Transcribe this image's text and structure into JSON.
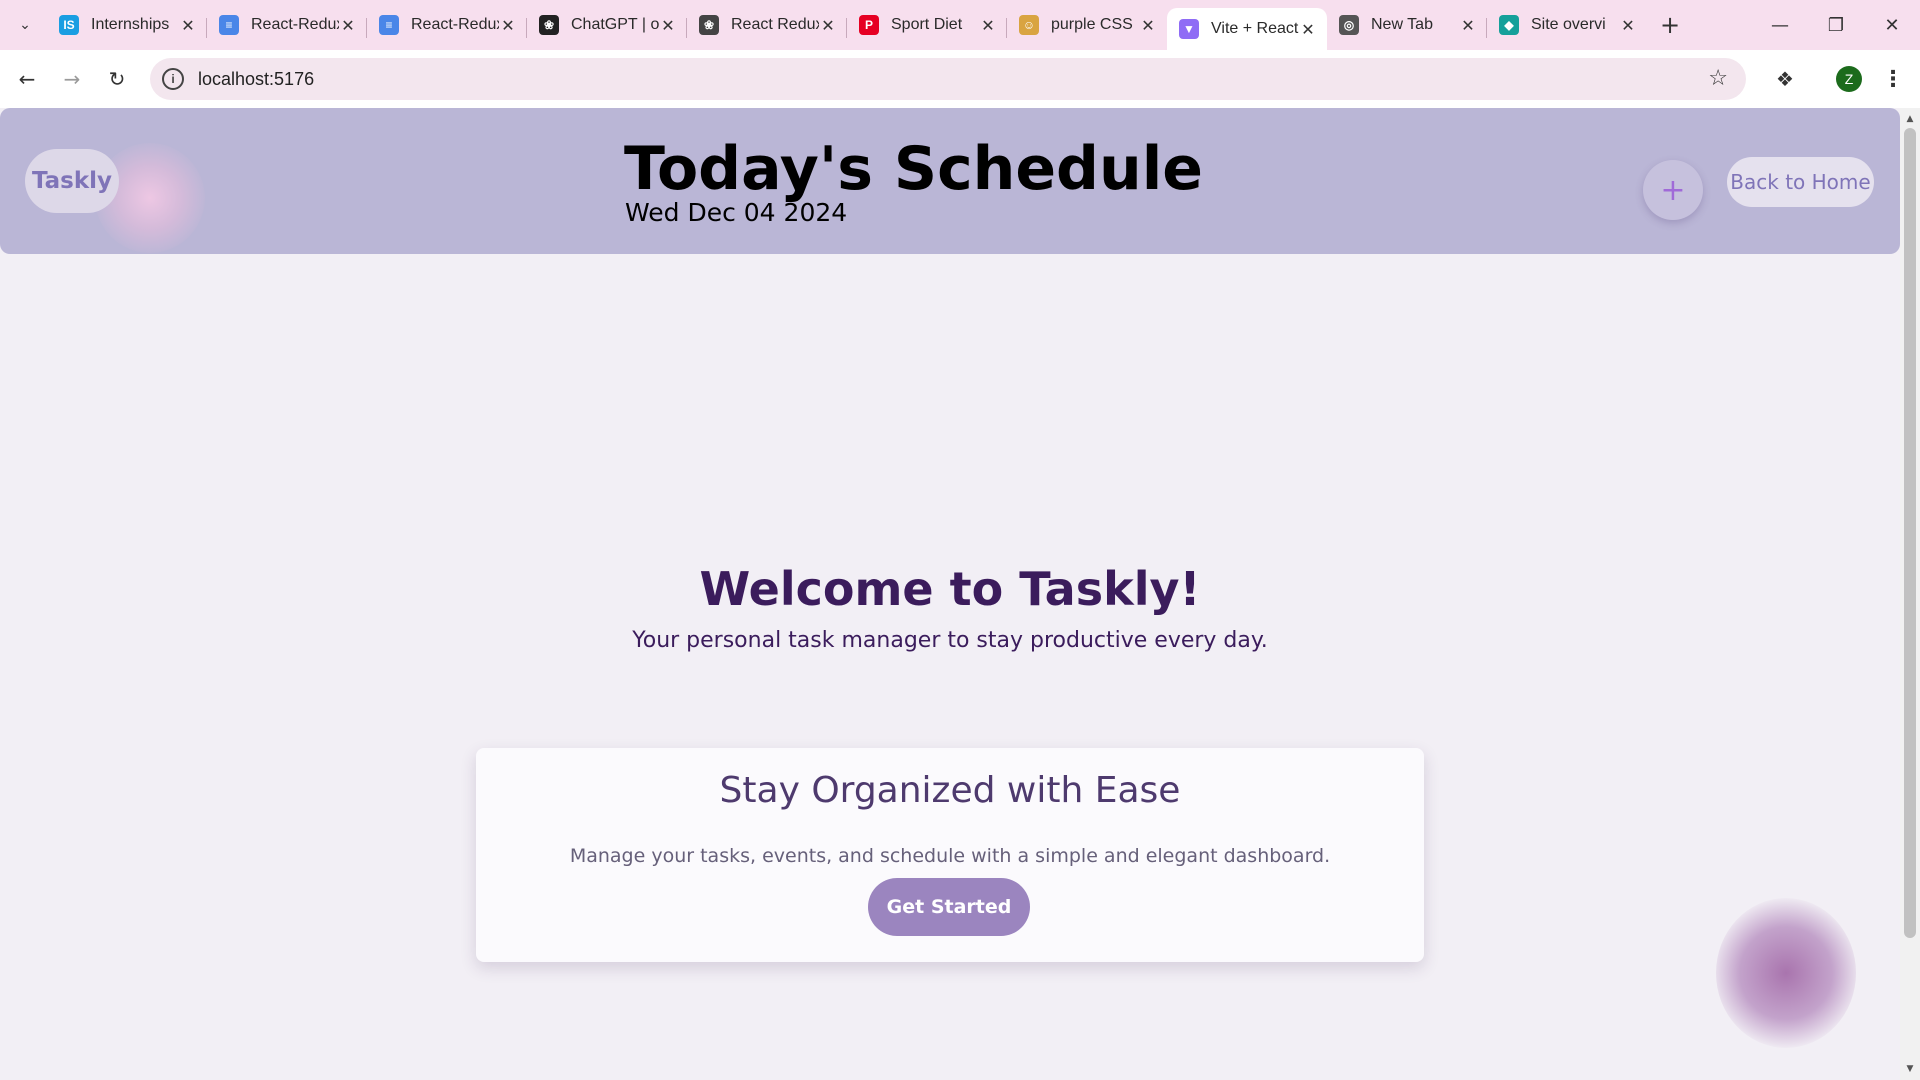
{
  "browser": {
    "tabs": [
      {
        "title": "Internships",
        "icon": "internshala-icon",
        "color": "#1a9ee2"
      },
      {
        "title": "React-Redux",
        "icon": "google-docs-icon",
        "color": "#4a86e8"
      },
      {
        "title": "React-Redux",
        "icon": "google-docs-icon",
        "color": "#4a86e8"
      },
      {
        "title": "ChatGPT | o",
        "icon": "chatgpt-icon",
        "color": "#222222"
      },
      {
        "title": "React Redux",
        "icon": "chatgpt-icon",
        "color": "#444444"
      },
      {
        "title": "Sport Diet",
        "icon": "pinterest-icon",
        "color": "#e60023"
      },
      {
        "title": "purple CSS",
        "icon": "emoji-icon",
        "color": "#d9a441"
      },
      {
        "title": "Vite + React",
        "icon": "vite-icon",
        "color": "#8f6cf5"
      },
      {
        "title": "New Tab",
        "icon": "chrome-icon",
        "color": "#555555"
      },
      {
        "title": "Site overvi",
        "icon": "netlify-icon",
        "color": "#15a09a"
      }
    ],
    "active_tab_index": 7,
    "address": "localhost:5176",
    "profile_initial": "Z"
  },
  "header": {
    "logo": "Taskly",
    "title": "Today's Schedule",
    "date": "Wed Dec 04 2024",
    "add_icon": "+",
    "back_label": "Back to Home"
  },
  "main": {
    "welcome": "Welcome to Taskly!",
    "tagline": "Your personal task manager to stay productive every day.",
    "card": {
      "title": "Stay Organized with Ease",
      "text": "Manage your tasks, events, and schedule with a simple and elegant dashboard.",
      "button": "Get Started"
    }
  },
  "colors": {
    "header_bg": "#bab6d6",
    "page_bg": "#f2eff5",
    "accent": "#9b85bf",
    "heading": "#3b1c5c"
  }
}
